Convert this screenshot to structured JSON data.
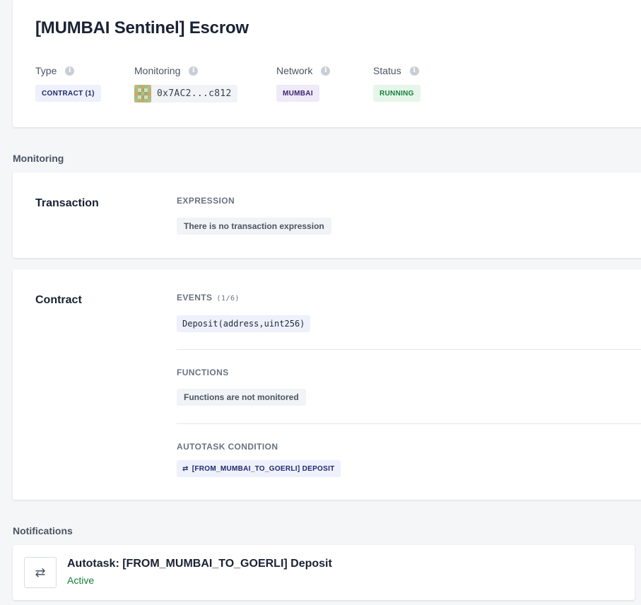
{
  "header": {
    "title": "[MUMBAI Sentinel] Escrow",
    "type_label": "Type",
    "type_value": "CONTRACT (1)",
    "monitoring_label": "Monitoring",
    "monitoring_address": "0x7AC2...c812",
    "network_label": "Network",
    "network_value": "MUMBAI",
    "status_label": "Status",
    "status_value": "RUNNING",
    "info_glyph": "i"
  },
  "monitoring_section": {
    "label": "Monitoring"
  },
  "transaction": {
    "title": "Transaction",
    "expression_label": "EXPRESSION",
    "expression_value": "There is no transaction expression"
  },
  "contract": {
    "title": "Contract",
    "events_label": "EVENTS",
    "events_count": "(1/6)",
    "event_value": "Deposit(address,uint256)",
    "functions_label": "FUNCTIONS",
    "functions_value": "Functions are not monitored",
    "autotask_label": "AUTOTASK CONDITION",
    "autotask_value": "[FROM_MUMBAI_TO_GOERLI] DEPOSIT"
  },
  "notifications": {
    "label": "Notifications",
    "items": [
      {
        "title": "Autotask: [FROM_MUMBAI_TO_GOERLI] Deposit",
        "status": "Active",
        "icon": "repeat-icon"
      }
    ]
  },
  "colors": {
    "accent_status": "#13803a",
    "network_bg": "#efeaf7",
    "type_bg": "#eef0fb"
  }
}
